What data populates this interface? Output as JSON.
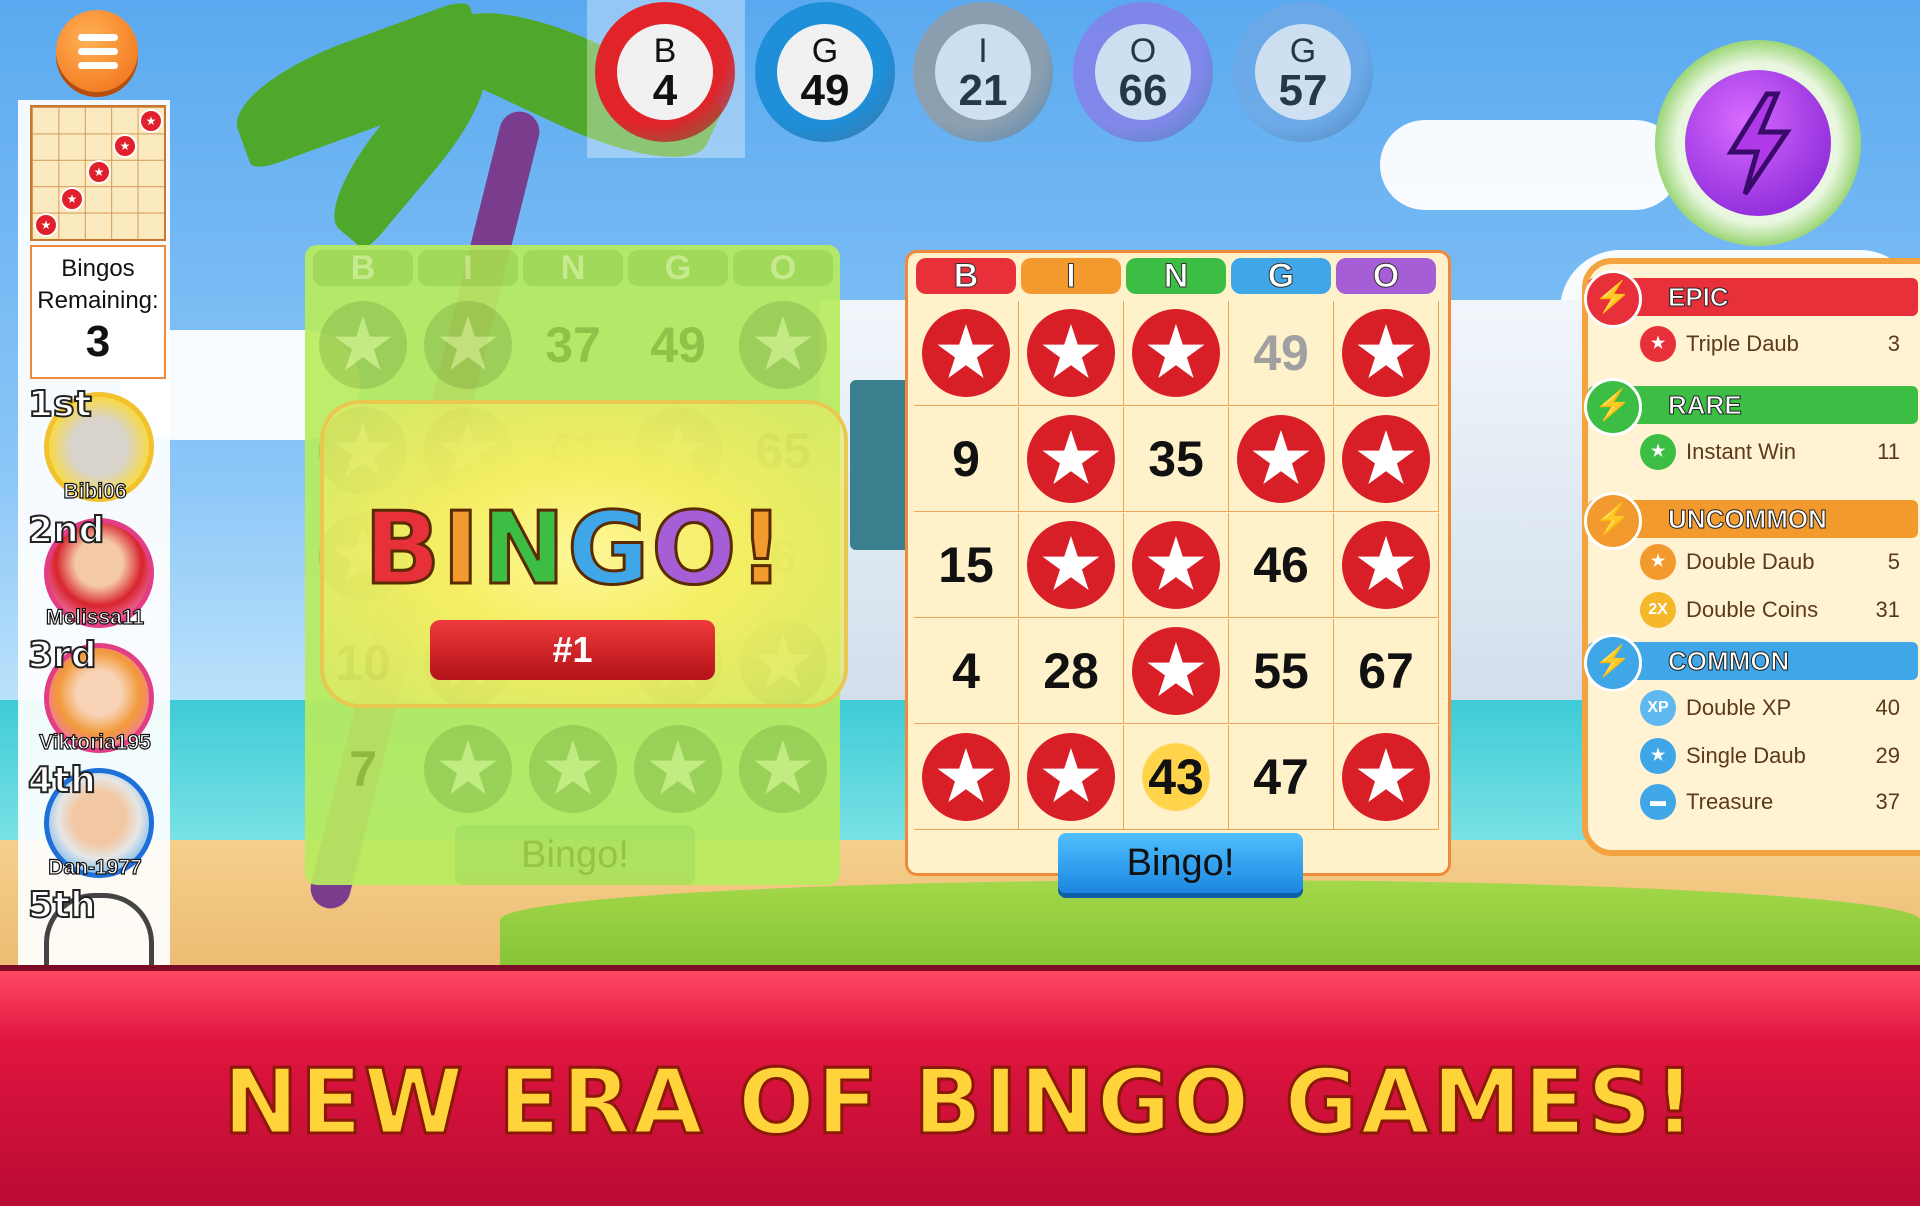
{
  "called_balls": [
    {
      "letter": "B",
      "number": "4",
      "color": "#e0242a"
    },
    {
      "letter": "G",
      "number": "49",
      "color": "#1e8fd8"
    },
    {
      "letter": "I",
      "number": "21",
      "color": "#9a9a9a"
    },
    {
      "letter": "O",
      "number": "66",
      "color": "#8a7be8"
    },
    {
      "letter": "G",
      "number": "57",
      "color": "#6fa8e6"
    }
  ],
  "sidebar": {
    "bingos_label": "Bingos Remaining:",
    "bingos_remaining": "3",
    "leaderboard": [
      {
        "rank": "1st",
        "name": "Bibi06"
      },
      {
        "rank": "2nd",
        "name": "Melissa11"
      },
      {
        "rank": "3rd",
        "name": "Viktoria195"
      },
      {
        "rank": "4th",
        "name": "Dan-1977"
      },
      {
        "rank": "5th",
        "name": ""
      }
    ]
  },
  "card_left": {
    "headers": [
      "B",
      "I",
      "N",
      "G",
      "O"
    ],
    "rows": [
      [
        "*",
        "*",
        "37",
        "49",
        "*"
      ],
      [
        "*",
        "*",
        "41",
        "*",
        "65"
      ],
      [
        "*",
        "*",
        "",
        "*",
        "6"
      ],
      [
        "10",
        "*",
        "",
        "*",
        "*"
      ],
      [
        "7",
        "*",
        "*",
        "*",
        "*"
      ]
    ],
    "bingo_banner": "BINGO!",
    "rank_badge": "#1",
    "bingo_button": "Bingo!"
  },
  "card_right": {
    "headers": [
      "B",
      "I",
      "N",
      "G",
      "O"
    ],
    "header_colors": [
      "#e8303a",
      "#f29a2e",
      "#3cbe45",
      "#3fa6e8",
      "#a65ed6"
    ],
    "rows": [
      [
        "*",
        "*",
        "*",
        "49",
        "*"
      ],
      [
        "9",
        "*",
        "35",
        "*",
        "*"
      ],
      [
        "15",
        "*",
        "*",
        "46",
        "*"
      ],
      [
        "4",
        "28",
        "*",
        "55",
        "67"
      ],
      [
        "*",
        "*",
        "43",
        "47",
        "*"
      ]
    ],
    "bingo_button": "Bingo!"
  },
  "powerups": [
    {
      "tier": "EPIC",
      "color": "#e8303a",
      "items": [
        {
          "name": "Triple Daub",
          "count": "3",
          "icon": "triple-daub-icon"
        }
      ]
    },
    {
      "tier": "RARE",
      "color": "#3cbe45",
      "items": [
        {
          "name": "Instant Win",
          "count": "11",
          "icon": "instant-win-icon"
        }
      ]
    },
    {
      "tier": "UNCOMMON",
      "color": "#f29a2e",
      "items": [
        {
          "name": "Double Daub",
          "count": "5",
          "icon": "double-daub-icon"
        },
        {
          "name": "Double Coins",
          "count": "31",
          "icon": "double-coins-icon",
          "badge": "2X"
        }
      ]
    },
    {
      "tier": "COMMON",
      "color": "#3fa6e8",
      "items": [
        {
          "name": "Double XP",
          "count": "40",
          "icon": "double-xp-icon",
          "badge": "XP"
        },
        {
          "name": "Single Daub",
          "count": "29",
          "icon": "single-daub-icon"
        },
        {
          "name": "Treasure",
          "count": "37",
          "icon": "treasure-icon"
        }
      ]
    }
  ],
  "tagline": "NEW ERA OF BINGO GAMES!"
}
